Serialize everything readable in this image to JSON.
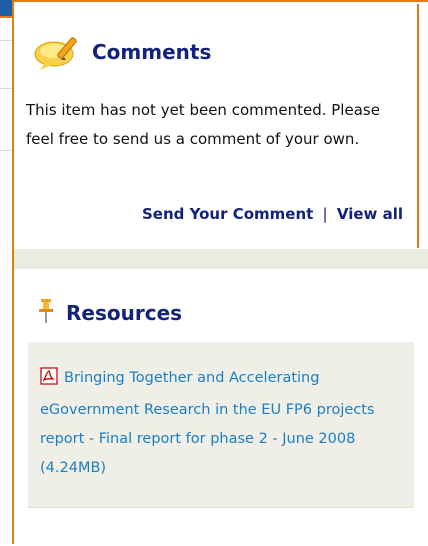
{
  "comments": {
    "title": "Comments",
    "body": "This item has not yet been commented. Please feel free to send us a comment of your own.",
    "send_link": "Send Your Comment",
    "separator": "|",
    "view_all_link": "View all"
  },
  "resources": {
    "title": "Resources",
    "items": [
      {
        "label": "Bringing Together and Accelerating eGovernment Research in the EU FP6 projects report - Final report for phase 2 - June 2008 (4.24MB)",
        "icon": "pdf-icon"
      }
    ]
  },
  "colors": {
    "heading": "#12237a",
    "link": "#1a7fc0",
    "accent_border": "#e07b10",
    "band": "#ecebe2",
    "resource_bg": "#f0efe7"
  }
}
